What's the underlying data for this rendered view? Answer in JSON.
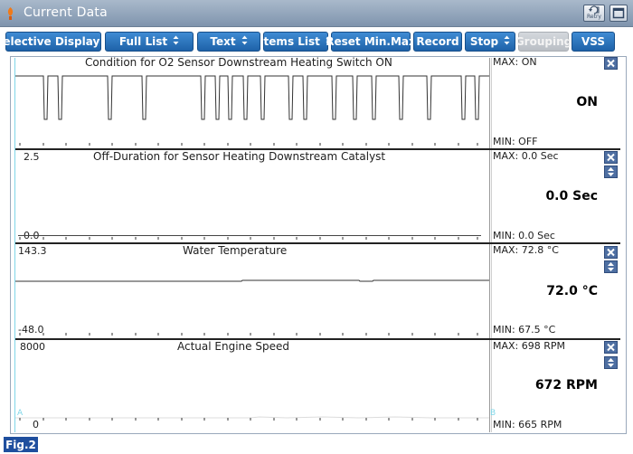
{
  "window": {
    "title": "Current Data",
    "retry_label": "Retry"
  },
  "toolbar": [
    {
      "label": "Selective Display",
      "has_spinner": true,
      "enabled": true
    },
    {
      "label": "Full List",
      "has_spinner": true,
      "enabled": true
    },
    {
      "label": "Text",
      "has_spinner": true,
      "enabled": true
    },
    {
      "label": "Items List",
      "has_spinner": true,
      "enabled": true
    },
    {
      "label": "Reset Min.Max",
      "has_spinner": false,
      "enabled": true
    },
    {
      "label": "Record",
      "has_spinner": false,
      "enabled": true
    },
    {
      "label": "Stop",
      "has_spinner": true,
      "enabled": true
    },
    {
      "label": "Grouping",
      "has_spinner": false,
      "enabled": false
    },
    {
      "label": "VSS",
      "has_spinner": false,
      "enabled": true
    }
  ],
  "graphs": [
    {
      "title": "Condition for O2 Sensor Downstream Heating Switch ON",
      "axis_top": "",
      "axis_bottom": "",
      "max": "MAX: ON",
      "min": "MIN: OFF",
      "current": "ON"
    },
    {
      "title": "Off-Duration for Sensor Heating Downstream Catalyst",
      "axis_top": "2.5",
      "axis_bottom": "0.0",
      "max": "MAX:   0.0 Sec",
      "min": "MIN:   0.0 Sec",
      "current": "0.0 Sec"
    },
    {
      "title": "Water Temperature",
      "axis_top": "143.3",
      "axis_bottom": "-48.0",
      "max": "MAX:  72.8 °C",
      "min": "MIN:  67.5 °C",
      "current": "72.0 °C"
    },
    {
      "title": "Actual Engine Speed",
      "axis_top": "8000",
      "axis_bottom": "0",
      "max": "MAX:   698 RPM",
      "min": "MIN:   665 RPM",
      "current": "672 RPM"
    }
  ],
  "markers": {
    "left": "A",
    "right": "B"
  },
  "figure_label": "Fig.2",
  "colors": {
    "toolbar_button": "#2a73bd",
    "titlebar": "#8ea1b8",
    "graph_line": "#333333",
    "cursor_line": "#7fd6e8"
  }
}
